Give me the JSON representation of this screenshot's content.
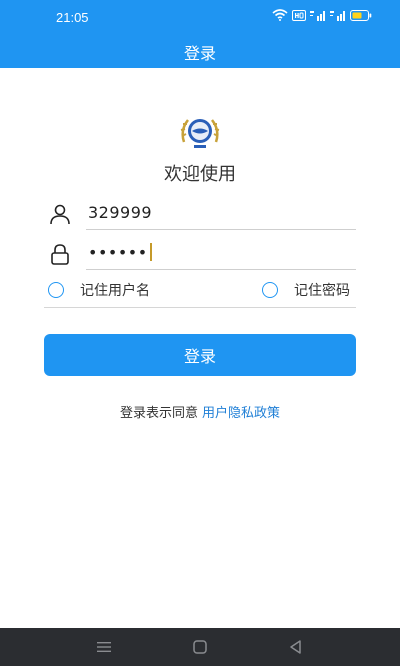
{
  "status": {
    "time": "21:05"
  },
  "header": {
    "title": "登录"
  },
  "welcome": "欢迎使用",
  "form": {
    "username_value": "329999",
    "password_value": "••••••"
  },
  "options": {
    "remember_user_label": "记住用户名",
    "remember_pass_label": "记住密码"
  },
  "login_button_label": "登录",
  "agreement": {
    "prefix": "登录表示同意",
    "link": "用户隐私政策"
  },
  "colors": {
    "primary": "#1f95f2",
    "link": "#1f7fd6",
    "nav_bar": "#2b2d31"
  },
  "icons": [
    "wifi-icon",
    "hd-icon",
    "signal-icon",
    "battery-icon",
    "user-icon",
    "lock-icon",
    "menu-icon",
    "home-icon",
    "back-icon"
  ]
}
